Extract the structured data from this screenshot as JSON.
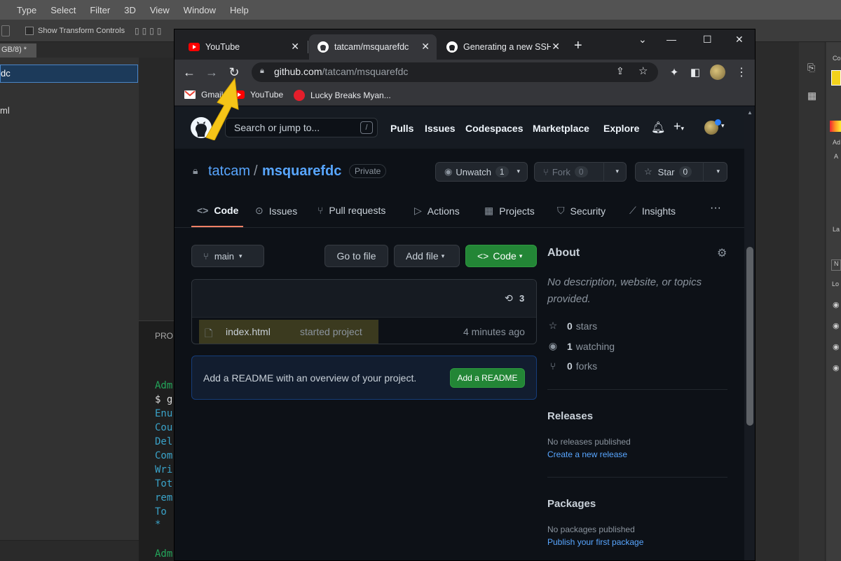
{
  "photoshop": {
    "menu": [
      "Type",
      "Select",
      "Filter",
      "3D",
      "View",
      "Window",
      "Help"
    ],
    "options_show_transform": "Show Transform Controls",
    "doc_tab": "GB/8) *",
    "left_selected": "dc",
    "left_item": "ml",
    "terminal_problems": "PRO",
    "terminal_lines": [
      "Adm",
      "$ g",
      "Enu",
      "Cou",
      "Del",
      "Com",
      "Wri",
      "Tot",
      "rem",
      "To ",
      " *",
      "Adm"
    ],
    "right_labels": [
      "Co",
      "Ad",
      "A",
      "La",
      "N",
      "Lo"
    ]
  },
  "chrome": {
    "tabs": [
      {
        "label": "YouTube",
        "icon": "youtube-icon"
      },
      {
        "label": "tatcam/msquarefdc",
        "icon": "github-icon",
        "active": true
      },
      {
        "label": "Generating a new SSH",
        "icon": "github-icon"
      }
    ],
    "url_host": "github.com",
    "url_path": "/tatcam/msquarefdc",
    "bookmarks": [
      {
        "label": "Gmail",
        "icon": "gmail-icon"
      },
      {
        "label": "YouTube",
        "icon": "youtube-icon"
      },
      {
        "label": "Lucky Breaks Myan...",
        "icon": "coca-cola-icon"
      }
    ]
  },
  "github": {
    "search_placeholder": "Search or jump to...",
    "search_key": "/",
    "nav": [
      "Pulls",
      "Issues",
      "Codespaces",
      "Marketplace",
      "Explore"
    ],
    "repo_owner": "tatcam",
    "repo_sep": "/",
    "repo_name": "msquarefdc",
    "repo_visibility": "Private",
    "unwatch_label": "Unwatch",
    "unwatch_count": "1",
    "fork_label": "Fork",
    "fork_count": "0",
    "star_label": "Star",
    "star_count": "0",
    "tabs": [
      "Code",
      "Issues",
      "Pull requests",
      "Actions",
      "Projects",
      "Security",
      "Insights"
    ],
    "active_tab": "Code",
    "more": "···",
    "branch": "main",
    "go_to_file": "Go to file",
    "add_file": "Add file",
    "code_button": "Code",
    "commit_count": "3",
    "files": [
      {
        "name": "index.html",
        "message": "started project",
        "time": "4 minutes ago"
      }
    ],
    "readme_prompt": "Add a README with an overview of your project.",
    "readme_button": "Add a README",
    "about": {
      "title": "About",
      "description": "No description, website, or topics provided.",
      "stars_count": "0",
      "stars_label": "stars",
      "watching_count": "1",
      "watching_label": "watching",
      "forks_count": "0",
      "forks_label": "forks"
    },
    "releases": {
      "title": "Releases",
      "empty": "No releases published",
      "link": "Create a new release"
    },
    "packages": {
      "title": "Packages",
      "empty": "No packages published",
      "link": "Publish your first package"
    }
  },
  "colors": {
    "accent_blue": "#58a6ff",
    "green_button": "#238636",
    "annotation_arrow": "#f5c518",
    "tab_underline": "#f78166"
  }
}
